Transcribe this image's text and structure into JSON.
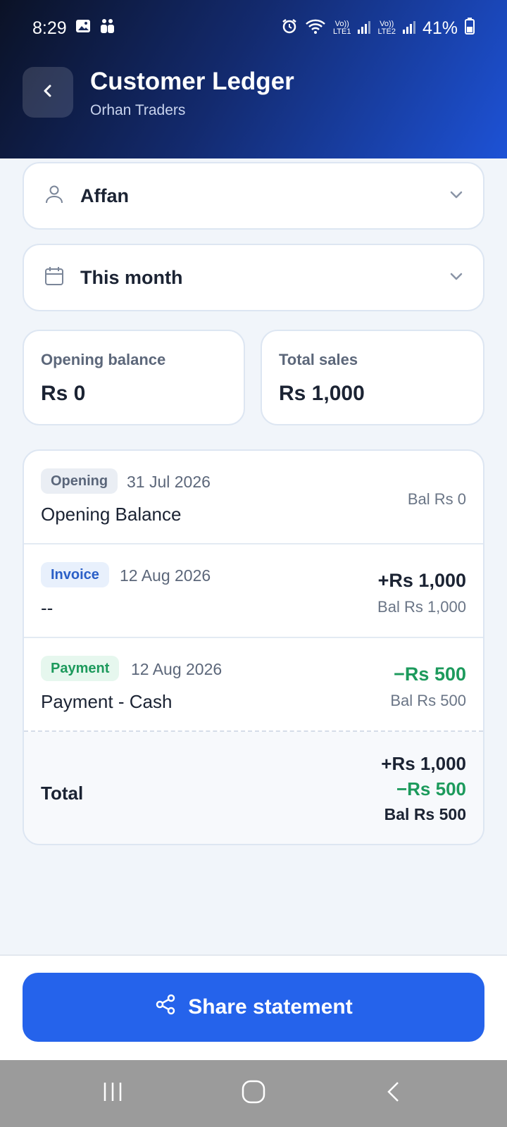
{
  "status_bar": {
    "time": "8:29",
    "battery": "41%",
    "lte1": "LTE1",
    "lte2": "LTE2",
    "volte": "Vo))"
  },
  "header": {
    "title": "Customer Ledger",
    "subtitle": "Orhan Traders"
  },
  "filters": {
    "customer": "Affan",
    "period": "This month"
  },
  "stats": {
    "opening_label": "Opening balance",
    "opening_value": "Rs 0",
    "sales_label": "Total sales",
    "sales_value": "Rs 1,000"
  },
  "ledger": {
    "rows": [
      {
        "tag": "Opening",
        "date": "31 Jul 2026",
        "description": "Opening Balance",
        "amount": "",
        "balance": "Bal Rs 0"
      },
      {
        "tag": "Invoice",
        "date": "12 Aug 2026",
        "description": "--",
        "amount": "+Rs 1,000",
        "balance": "Bal Rs 1,000"
      },
      {
        "tag": "Payment",
        "date": "12 Aug 2026",
        "description": "Payment - Cash",
        "amount": "−Rs 500",
        "balance": "Bal Rs 500"
      }
    ],
    "total": {
      "label": "Total",
      "debit": "+Rs 1,000",
      "credit": "−Rs 500",
      "balance": "Bal Rs 500"
    }
  },
  "actions": {
    "share_label": "Share statement"
  },
  "colors": {
    "accent": "#2563eb",
    "positive": "#1c9a5c",
    "invoice_tag": "#2a5fc7"
  },
  "icons": {
    "back": "chevron-left-icon",
    "customer": "user-icon",
    "period": "calendar-icon",
    "dropdown": "chevron-down-icon",
    "share": "share-icon"
  }
}
